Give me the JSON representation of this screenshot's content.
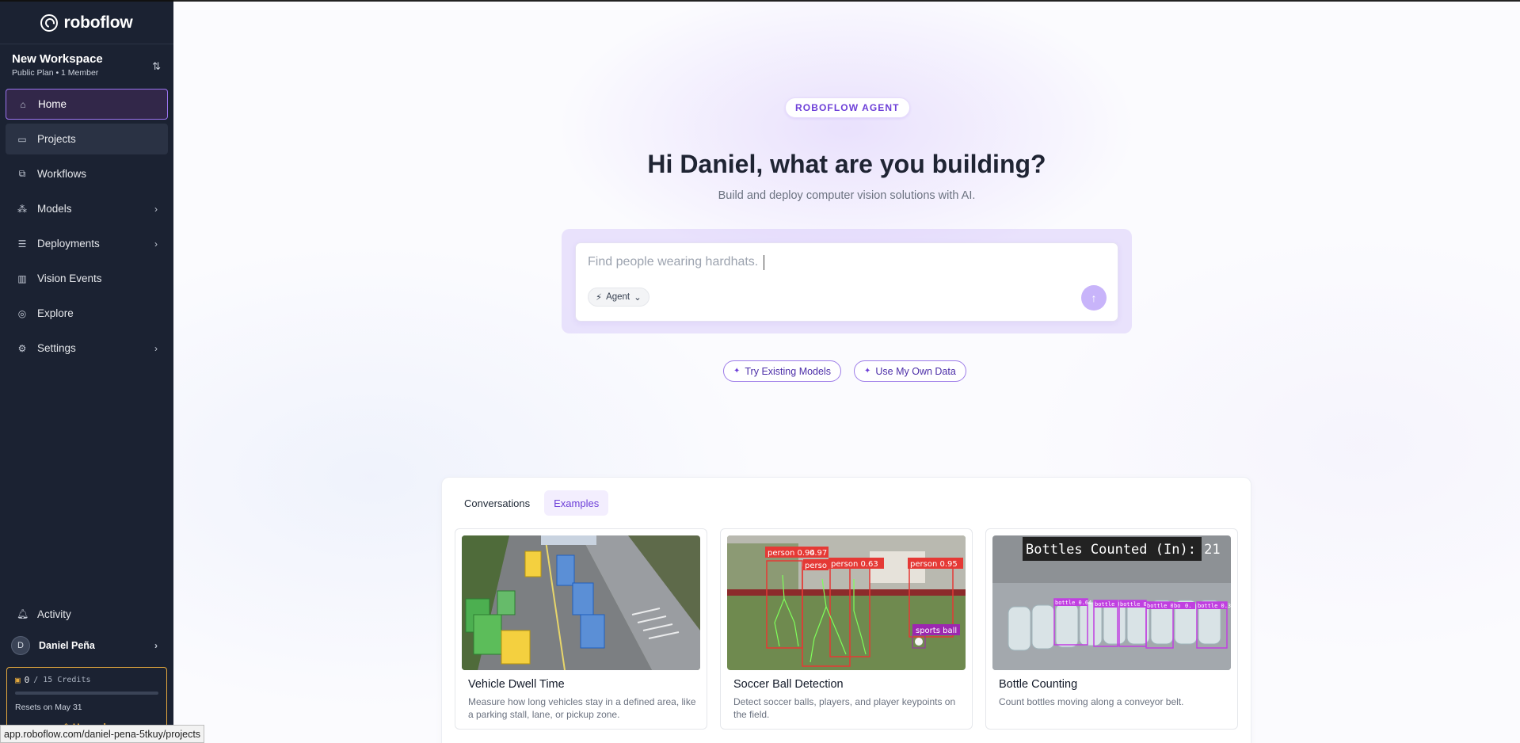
{
  "brand": {
    "name": "roboflow"
  },
  "workspace": {
    "name": "New Workspace",
    "plan": "Public Plan • 1 Member"
  },
  "nav": [
    {
      "label": "Home",
      "icon": "home-icon",
      "active": true
    },
    {
      "label": "Projects",
      "icon": "inbox-icon"
    },
    {
      "label": "Workflows",
      "icon": "workflow-icon"
    },
    {
      "label": "Models",
      "icon": "models-icon",
      "chevron": true
    },
    {
      "label": "Deployments",
      "icon": "server-icon",
      "chevron": true
    },
    {
      "label": "Vision Events",
      "icon": "chart-icon"
    },
    {
      "label": "Explore",
      "icon": "compass-icon"
    },
    {
      "label": "Settings",
      "icon": "gear-icon",
      "chevron": true
    }
  ],
  "bottom": {
    "activity": "Activity",
    "user": {
      "initial": "D",
      "name": "Daniel Peña"
    },
    "credits": {
      "used": "0",
      "total": "/ 15 Credits",
      "fraction_used": 0,
      "reset": "Resets on May 31",
      "upgrade": "Upgrade"
    }
  },
  "status_url": "app.roboflow.com/daniel-pena-5tkuy/projects",
  "hero": {
    "badge": "ROBOFLOW AGENT",
    "headline": "Hi Daniel, what are you building?",
    "subline": "Build and deploy computer vision solutions with AI."
  },
  "prompt": {
    "placeholder": "Find people wearing hardhats.",
    "mode": "Agent"
  },
  "chips": [
    "Try Existing Models",
    "Use My Own Data"
  ],
  "tabs": [
    {
      "label": "Conversations",
      "active": false
    },
    {
      "label": "Examples",
      "active": true
    }
  ],
  "examples": [
    {
      "title": "Vehicle Dwell Time",
      "desc": "Measure how long vehicles stay in a defined area, like a parking stall, lane, or pickup zone."
    },
    {
      "title": "Soccer Ball Detection",
      "desc": "Detect soccer balls, players, and player keypoints on the field.",
      "labels": [
        "person 0.94",
        "0.97",
        "perso",
        "person 0.63",
        "person 0.95",
        "sports ball"
      ]
    },
    {
      "title": "Bottle Counting",
      "desc": "Count bottles moving along a conveyor belt.",
      "overlay": "Bottles Counted (In): 21",
      "labels": [
        "bottle 0.64",
        "bottle 0.7",
        "bottle 0",
        "bottle 0.71",
        "bo",
        "0.",
        "bottle 0.32"
      ]
    }
  ],
  "colors": {
    "accent": "#6d3fd8",
    "sidebar_bg": "#1b2232",
    "credit": "#e5a93d"
  }
}
